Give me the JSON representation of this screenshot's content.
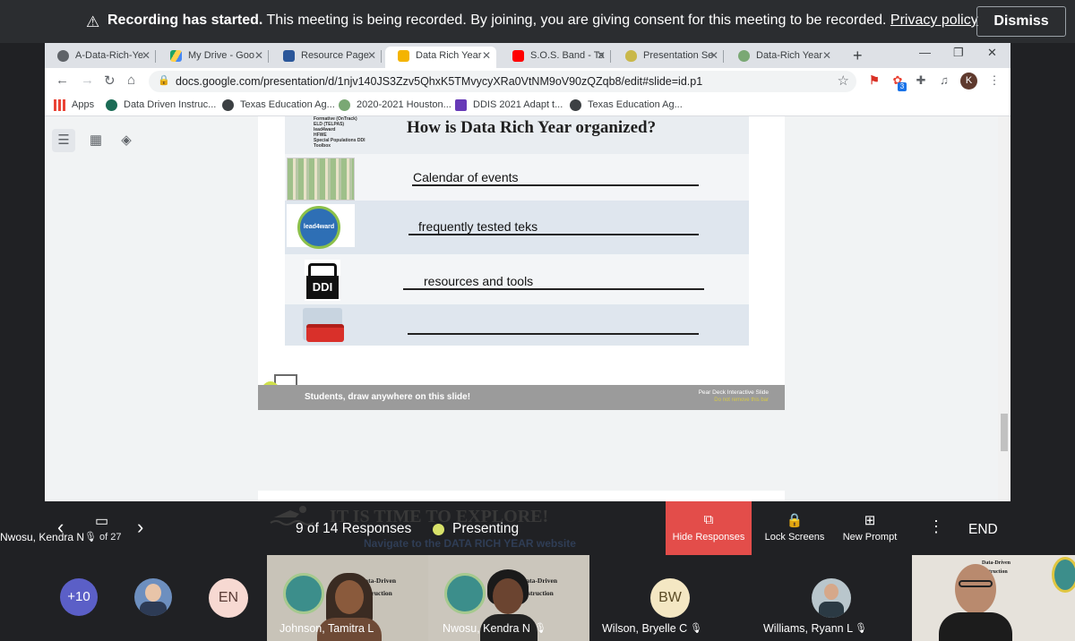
{
  "banner": {
    "bold": "Recording has started.",
    "text": "This meeting is being recorded. By joining, you are giving consent for this meeting to be recorded.",
    "link": "Privacy policy",
    "dismiss": "Dismiss"
  },
  "browser": {
    "tabs": [
      {
        "label": "A-Data-Rich-Ye",
        "icon_color": "#5f6368"
      },
      {
        "label": "My Drive - Goo",
        "icon_color": "#1fa463"
      },
      {
        "label": "Resource Page",
        "icon_color": "#2b579a"
      },
      {
        "label": "Data Rich Year",
        "icon_color": "#f4b400",
        "active": true
      },
      {
        "label": "S.O.S. Band - Ta",
        "icon_color": "#ff0000"
      },
      {
        "label": "Presentation Se",
        "icon_color": "#c9b84a"
      },
      {
        "label": "Data-Rich Year",
        "icon_color": "#7aa874"
      }
    ],
    "url": "docs.google.com/presentation/d/1njv140JS3Zzv5QhxK5TMvycyXRa0VtNM9oV90zQZqb8/edit#slide=id.p1",
    "extension_badge": "3",
    "profile_initial": "K",
    "bookmarks": [
      {
        "label": "Apps",
        "icon_color": "#ea4335"
      },
      {
        "label": "Data Driven Instruc...",
        "icon_color": "#1b6b55"
      },
      {
        "label": "Texas Education Ag...",
        "icon_color": "#3c4043"
      },
      {
        "label": "2020-2021 Houston...",
        "icon_color": "#7aa874"
      },
      {
        "label": "DDIS 2021 Adapt t...",
        "icon_color": "#673ab7"
      },
      {
        "label": "Texas Education Ag...",
        "icon_color": "#3c4043"
      }
    ]
  },
  "slide": {
    "title": "How is Data Rich Year organized?",
    "mini_list": "Formative (OnTrack)\nELD (TELPAS)\nlead4ward\nHFWE\nSpecial Populations DDI\nToolbox",
    "rows": [
      {
        "text": "Calendar of events"
      },
      {
        "text": "frequently tested teks",
        "logo": "lead4ward"
      },
      {
        "text": "resources and tools",
        "logo": "DDI"
      },
      {
        "text": ""
      }
    ],
    "peardeck_students": "Students, draw anywhere on this slide!",
    "peardeck_label": "Pear Deck Interactive Slide",
    "peardeck_note": "Do not remove this bar"
  },
  "presenter": {
    "presenter_name": "Nwosu, Kendra N",
    "page_of": "of 27",
    "responses": "9 of 14 Responses",
    "status": "Presenting",
    "hide_responses": "Hide Responses",
    "lock_screens": "Lock Screens",
    "new_prompt": "New Prompt",
    "end": "END",
    "overlay_title": "IT IS TIME TO EXPLORE!",
    "overlay_sub": "Navigate to the DATA RICH YEAR website"
  },
  "participants": {
    "more": "+10",
    "en_initials": "EN",
    "bw_initials": "BW",
    "people": [
      {
        "name": "Johnson, Tamitra L"
      },
      {
        "name": "Nwosu, Kendra N"
      },
      {
        "name": "Wilson, Bryelle C"
      },
      {
        "name": "Williams, Ryann L"
      }
    ],
    "ddi_text": "Data-Driven\nInstruction"
  }
}
